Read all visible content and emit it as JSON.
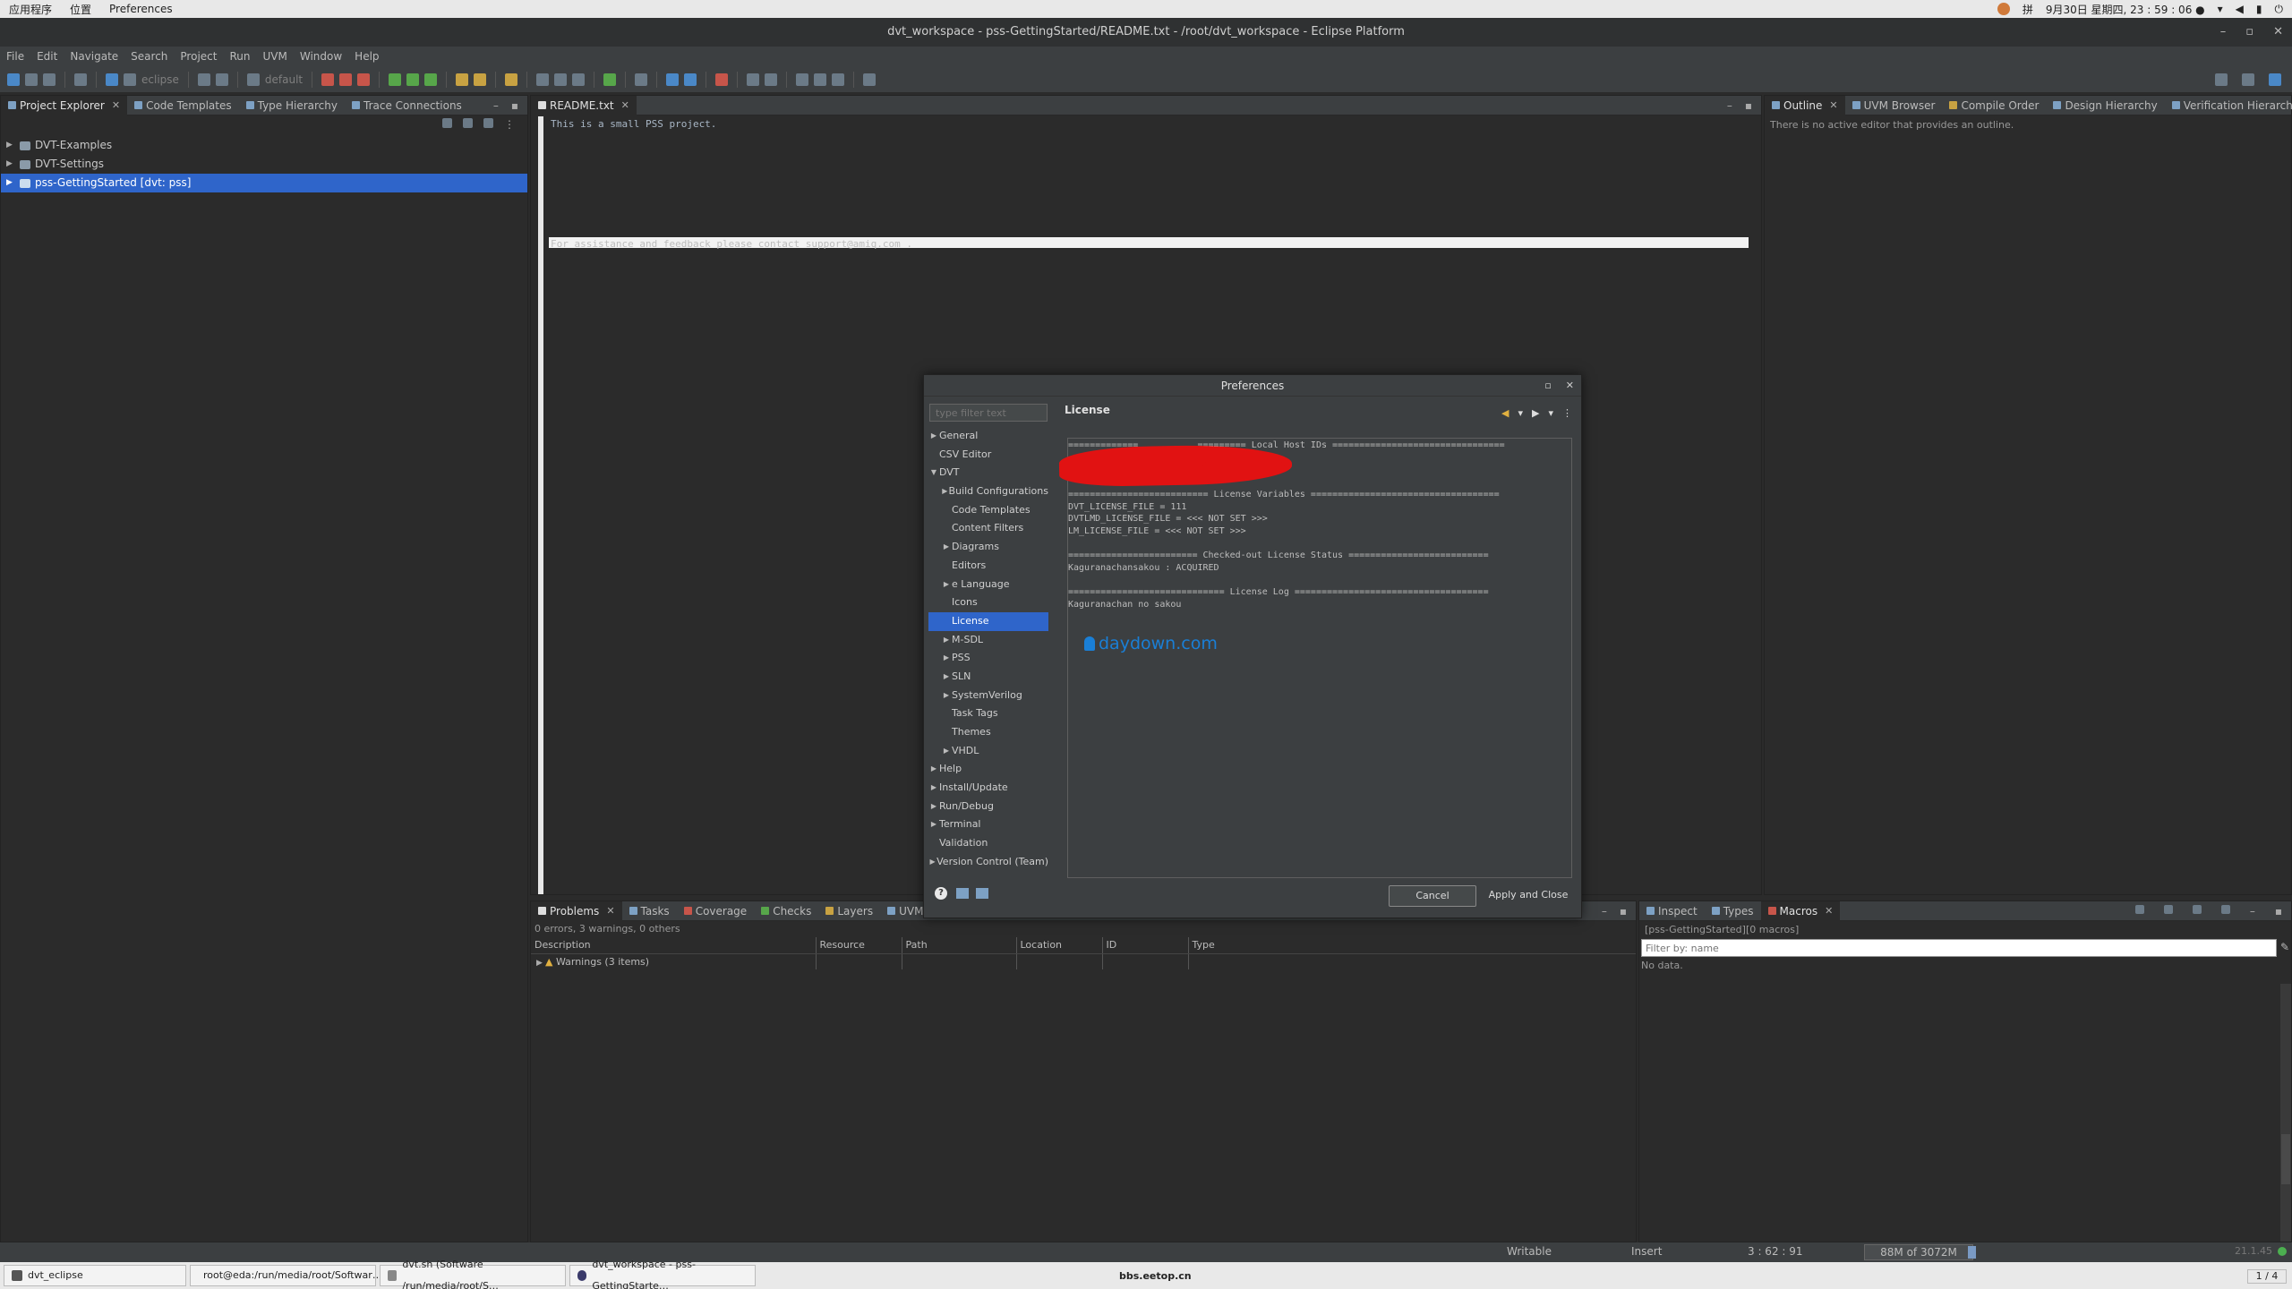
{
  "system_bar": {
    "apps_menu": "应用程序",
    "places_menu": "位置",
    "active_app": "Preferences",
    "ime": "拼",
    "clock": "9月30日 星期四, 23 : 59 : 06 ●"
  },
  "window": {
    "title": "dvt_workspace - pss-GettingStarted/README.txt - /root/dvt_workspace - Eclipse Platform"
  },
  "menu": [
    "File",
    "Edit",
    "Navigate",
    "Search",
    "Project",
    "Run",
    "UVM",
    "Window",
    "Help"
  ],
  "toolbar": {
    "eclipse_combo": "eclipse",
    "default_combo": "default"
  },
  "left_tabs": [
    {
      "label": "Project Explorer"
    },
    {
      "label": "Code Templates"
    },
    {
      "label": "Type Hierarchy"
    },
    {
      "label": "Trace Connections"
    }
  ],
  "project_tree": [
    {
      "label": "DVT-Examples"
    },
    {
      "label": "DVT-Settings"
    },
    {
      "label": "pss-GettingStarted [dvt: pss]"
    }
  ],
  "editor": {
    "tab": "README.txt",
    "lines": [
      "This is a small PSS project.",
      "For assistance and feedback please contact support@amiq.com ."
    ]
  },
  "right_tabs": [
    {
      "label": "Outline"
    },
    {
      "label": "UVM Browser"
    },
    {
      "label": "Compile Order"
    },
    {
      "label": "Design Hierarchy"
    },
    {
      "label": "Verification Hierarchy"
    }
  ],
  "outline_message": "There is no active editor that provides an outline.",
  "problems": {
    "tabs": [
      "Problems",
      "Tasks",
      "Coverage",
      "Checks",
      "Layers",
      "UVM Sequence Tr"
    ],
    "summary": "0 errors, 3 warnings, 0 others",
    "columns": [
      "Description",
      "Resource",
      "Path",
      "Location",
      "ID",
      "Type"
    ],
    "rows": [
      "Warnings (3 items)"
    ]
  },
  "macros": {
    "tabs": [
      "Inspect",
      "Types",
      "Macros"
    ],
    "context": "[pss-GettingStarted][0 macros]",
    "filter_placeholder": "Filter by: name",
    "empty": "No data."
  },
  "status": {
    "writable": "Writable",
    "insert": "Insert",
    "position": "3 : 62 : 91",
    "memory": "88M of 3072M",
    "right_info": "21.1.45"
  },
  "taskbar": {
    "tasks": [
      "dvt_eclipse",
      "root@eda:/run/media/root/Softwar…",
      "dvt.sh (Software /run/media/root/S…",
      "dvt_workspace - pss-GettingStarte…"
    ],
    "center": "bbs.eetop.cn",
    "pager": "1 / 4"
  },
  "dialog": {
    "title": "Preferences",
    "filter_placeholder": "type filter text",
    "page_title": "License",
    "tree": [
      {
        "label": "General",
        "level": 0,
        "arrow": "right"
      },
      {
        "label": "CSV Editor",
        "level": 0,
        "arrow": ""
      },
      {
        "label": "DVT",
        "level": 0,
        "arrow": "down"
      },
      {
        "label": "Build Configurations",
        "level": 1,
        "arrow": "right"
      },
      {
        "label": "Code Templates",
        "level": 1,
        "arrow": ""
      },
      {
        "label": "Content Filters",
        "level": 1,
        "arrow": ""
      },
      {
        "label": "Diagrams",
        "level": 1,
        "arrow": "right"
      },
      {
        "label": "Editors",
        "level": 1,
        "arrow": ""
      },
      {
        "label": "e Language",
        "level": 1,
        "arrow": "right"
      },
      {
        "label": "Icons",
        "level": 1,
        "arrow": ""
      },
      {
        "label": "License",
        "level": 1,
        "arrow": "",
        "selected": true
      },
      {
        "label": "M-SDL",
        "level": 1,
        "arrow": "right"
      },
      {
        "label": "PSS",
        "level": 1,
        "arrow": "right"
      },
      {
        "label": "SLN",
        "level": 1,
        "arrow": "right"
      },
      {
        "label": "SystemVerilog",
        "level": 1,
        "arrow": "right"
      },
      {
        "label": "Task Tags",
        "level": 1,
        "arrow": ""
      },
      {
        "label": "Themes",
        "level": 1,
        "arrow": ""
      },
      {
        "label": "VHDL",
        "level": 1,
        "arrow": "right"
      },
      {
        "label": "Help",
        "level": 0,
        "arrow": "right"
      },
      {
        "label": "Install/Update",
        "level": 0,
        "arrow": "right"
      },
      {
        "label": "Run/Debug",
        "level": 0,
        "arrow": "right"
      },
      {
        "label": "Terminal",
        "level": 0,
        "arrow": "right"
      },
      {
        "label": "Validation",
        "level": 0,
        "arrow": ""
      },
      {
        "label": "Version Control (Team)",
        "level": 0,
        "arrow": "right"
      }
    ],
    "license_lines": [
      "=============           ========= Local Host IDs ================================",
      "",
      "",
      "",
      "========================== License Variables ===================================",
      "DVT_LICENSE_FILE = 111",
      "DVTLMD_LICENSE_FILE = <<< NOT SET >>>",
      "LM_LICENSE_FILE = <<< NOT SET >>>",
      "",
      "======================== Checked-out License Status ==========================",
      "Kaguranachansakou : ACQUIRED",
      "",
      "============================= License Log ====================================",
      "Kaguranachan no sakou"
    ],
    "watermark": "daydown.com",
    "cancel": "Cancel",
    "apply_close": "Apply and Close"
  }
}
